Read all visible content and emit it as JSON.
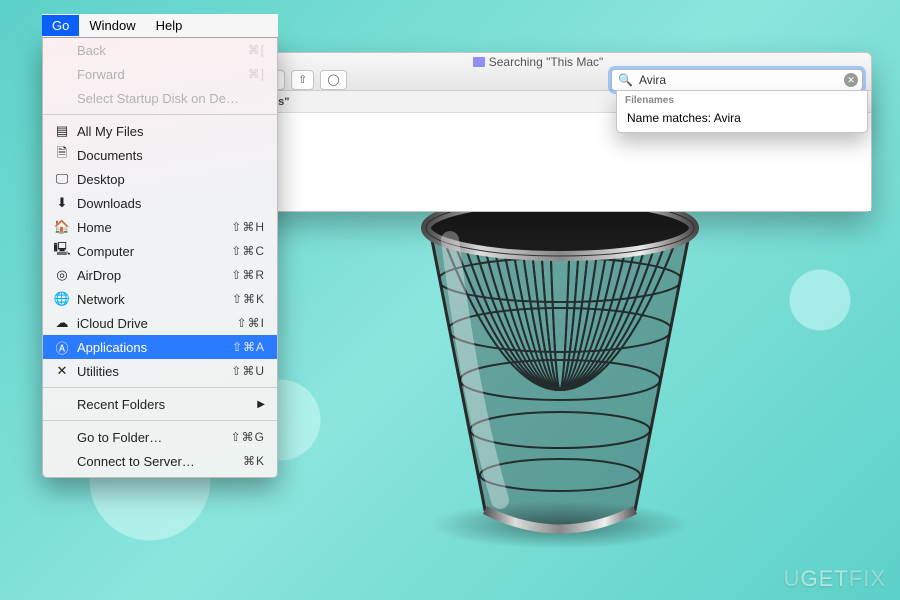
{
  "menubar": {
    "go": "Go",
    "window": "Window",
    "help": "Help"
  },
  "dropdown": {
    "back": "Back",
    "back_shortcut": "⌘[",
    "forward": "Forward",
    "forward_shortcut": "⌘]",
    "startup": "Select Startup Disk on De…",
    "allfiles": "All My Files",
    "documents": "Documents",
    "desktop": "Desktop",
    "downloads": "Downloads",
    "home": "Home",
    "home_shortcut": "⇧⌘H",
    "computer": "Computer",
    "computer_shortcut": "⇧⌘C",
    "airdrop": "AirDrop",
    "airdrop_shortcut": "⇧⌘R",
    "network": "Network",
    "network_shortcut": "⇧⌘K",
    "icloud": "iCloud Drive",
    "icloud_shortcut": "⇧⌘I",
    "applications": "Applications",
    "applications_shortcut": "⇧⌘A",
    "utilities": "Utilities",
    "utilities_shortcut": "⇧⌘U",
    "recent": "Recent Folders",
    "goto": "Go to Folder…",
    "goto_shortcut": "⇧⌘G",
    "connect": "Connect to Server…",
    "connect_shortcut": "⌘K"
  },
  "finder": {
    "title": "Searching \"This Mac\"",
    "nav_back": "‹",
    "nav_fwd": "›",
    "action_gear": "✻ ▾",
    "share": "⇧",
    "tags": "◯",
    "search_value": "Avira",
    "scope_prefix": "",
    "scope_app": "\"Applications\""
  },
  "suggestions": {
    "header": "Filenames",
    "item1": "Name matches: Avira"
  },
  "watermark": {
    "text_u": "U",
    "text_get": "GET",
    "text_fix": "FIX"
  }
}
